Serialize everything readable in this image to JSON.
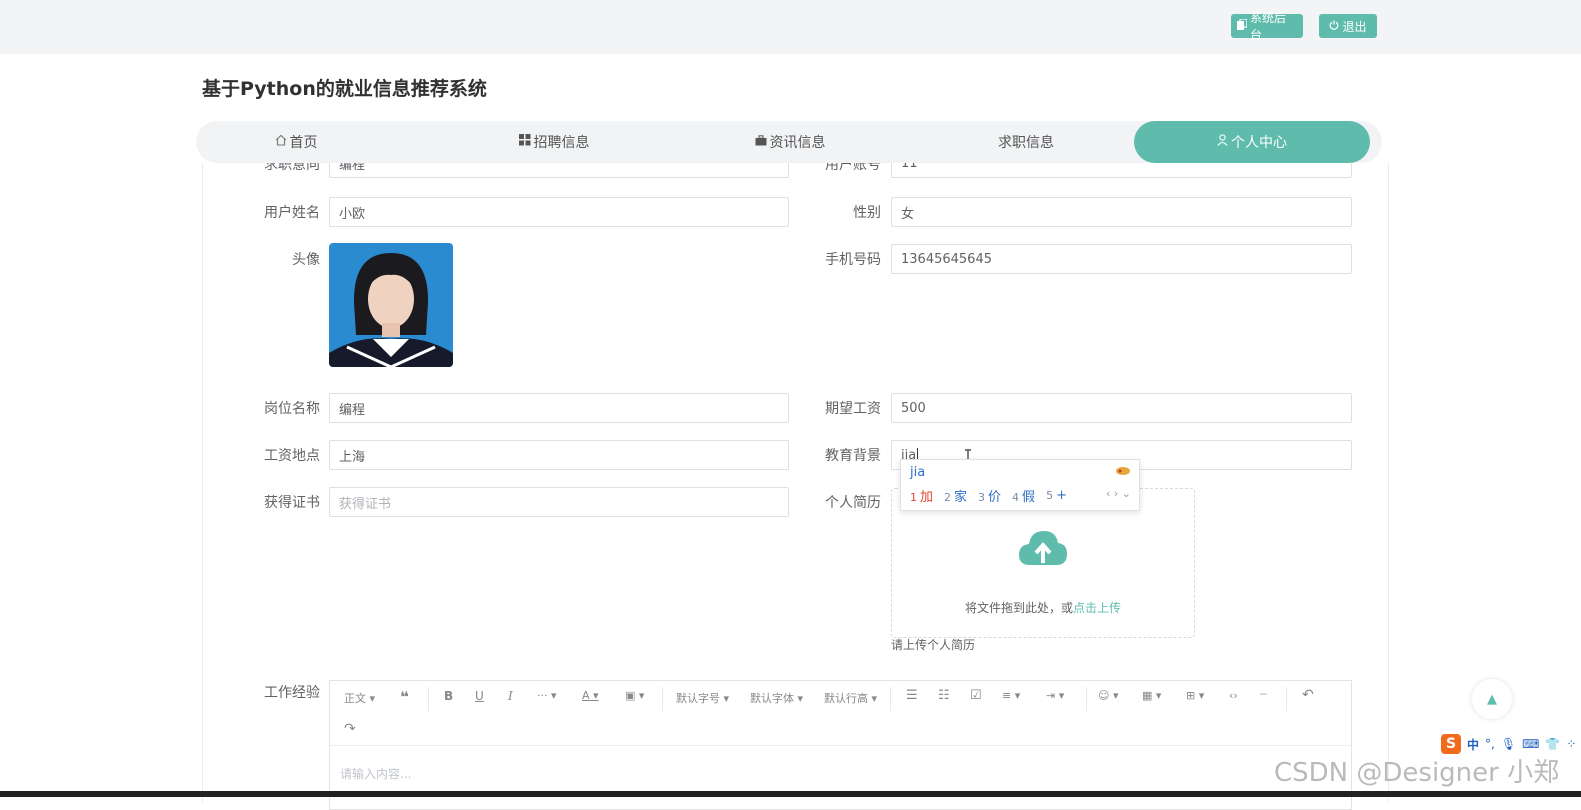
{
  "topbar": {
    "admin_label": "系统后台",
    "logout_label": "退出"
  },
  "site_title": "基于Python的就业信息推荐系统",
  "nav": {
    "items": [
      "首页",
      "招聘信息",
      "资讯信息",
      "求职信息",
      "个人中心"
    ],
    "active": "个人中心"
  },
  "form": {
    "row0": {
      "left_label": "求职意向",
      "left_value": "编程",
      "right_label": "用户账号",
      "right_value": "11"
    },
    "name_label": "用户姓名",
    "name_value": "小欧",
    "gender_label": "性别",
    "gender_value": "女",
    "avatar_label": "头像",
    "phone_label": "手机号码",
    "phone_value": "13645645645",
    "job_label": "岗位名称",
    "job_value": "编程",
    "salary_label": "期望工资",
    "salary_value": "500",
    "location_label": "工资地点",
    "location_value": "上海",
    "edu_label": "教育背景",
    "edu_value": "jia",
    "cert_label": "获得证书",
    "cert_placeholder": "获得证书",
    "resume_label": "个人简历",
    "upload_text": "将文件拖到此处，或",
    "upload_link": "点击上传",
    "upload_tip": "请上传个人简历",
    "exp_label": "工作经验",
    "editor_placeholder": "请输入内容..."
  },
  "editor_toolbar": {
    "paragraph": "正文",
    "font_size": "默认字号",
    "font_family": "默认字体",
    "line_height": "默认行高"
  },
  "ime": {
    "input": "jia",
    "candidates": [
      {
        "n": "1",
        "c": "加"
      },
      {
        "n": "2",
        "c": "家"
      },
      {
        "n": "3",
        "c": "价"
      },
      {
        "n": "4",
        "c": "假"
      },
      {
        "n": "5",
        "c": "+"
      }
    ]
  },
  "sogou": {
    "mode": "中"
  },
  "watermark": "CSDN @Designer 小郑",
  "colors": {
    "accent": "#5fbcac",
    "ime_text": "#2f6fc6",
    "ime_first": "#e2462e"
  }
}
